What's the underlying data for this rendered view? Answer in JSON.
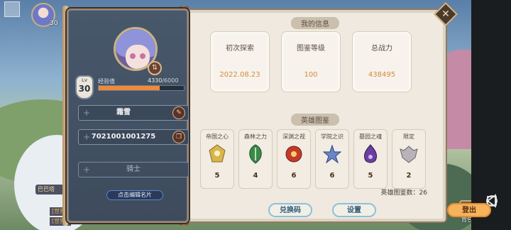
{
  "hud": {
    "top_level": "30",
    "side_label_a": "巴巴塔",
    "side_label_b": "[世界]",
    "side_label_c": "[世界]",
    "backpack_label": "背包"
  },
  "profile": {
    "level_label": "Lv",
    "level": "30",
    "exp_label": "经验值",
    "exp_current": "4330",
    "exp_max": "/6000",
    "exp_progress": 0.72,
    "name": "霜雪",
    "player_id": "7021001001275",
    "title": "骑士",
    "edit_card_label": "点击编辑名片"
  },
  "info": {
    "section_title": "我的信息",
    "cards": [
      {
        "label": "初次探索",
        "value": "2022.08.23"
      },
      {
        "label": "图鉴等级",
        "value": "100"
      },
      {
        "label": "总战力",
        "value": "438495"
      }
    ]
  },
  "heroes": {
    "section_title": "英雄图鉴",
    "categories": [
      {
        "name": "帝国之心",
        "count": "5",
        "icon": "gold-crest-icon",
        "color": "#d8b54d"
      },
      {
        "name": "森林之力",
        "count": "4",
        "icon": "green-leaf-crest-icon",
        "color": "#3b8a4c"
      },
      {
        "name": "深渊之视",
        "count": "6",
        "icon": "red-eye-crest-icon",
        "color": "#c43a2a"
      },
      {
        "name": "学院之识",
        "count": "6",
        "icon": "blue-star-crest-icon",
        "color": "#6a86c9"
      },
      {
        "name": "墓园之魂",
        "count": "5",
        "icon": "purple-flame-crest-icon",
        "color": "#6a3fa0"
      },
      {
        "name": "限定",
        "count": "2",
        "icon": "silver-wing-crest-icon",
        "color": "#b7b3b8"
      }
    ],
    "total_label": "英雄图鉴数：26"
  },
  "buttons": {
    "redeem": "兑换码",
    "settings": "设置",
    "logout": "登出"
  }
}
